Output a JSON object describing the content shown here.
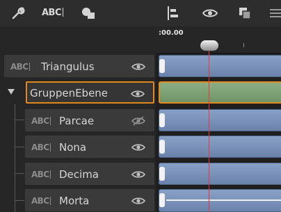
{
  "toolbar": {
    "text_tool_label": "ABC",
    "icons": [
      "wrench-icon",
      "text-tool-icon",
      "shapes-icon",
      "align-left-icon",
      "visibility-toggle-icon",
      "duplicate-icon",
      "menu-icon"
    ]
  },
  "timeline": {
    "time_display": ":00.00",
    "playhead_time": ":00.00"
  },
  "layers": [
    {
      "name": "Triangulus",
      "type_label": "ABC",
      "visible": true,
      "indent": 0
    },
    {
      "name": "GruppenEbene",
      "type": "group",
      "expanded": true,
      "selected": true,
      "visible": true,
      "indent": 0
    },
    {
      "name": "Parcae",
      "type_label": "ABC",
      "visible": false,
      "indent": 1
    },
    {
      "name": "Nona",
      "type_label": "ABC",
      "visible": true,
      "indent": 1
    },
    {
      "name": "Decima",
      "type_label": "ABC",
      "visible": true,
      "indent": 1
    },
    {
      "name": "Morta",
      "type_label": "ABC",
      "visible": true,
      "indent": 1
    }
  ],
  "colors": {
    "selection_accent": "#e08a1e",
    "text_track": "#7b93bb",
    "group_track": "#7fa176",
    "playhead": "#e43a3a"
  }
}
